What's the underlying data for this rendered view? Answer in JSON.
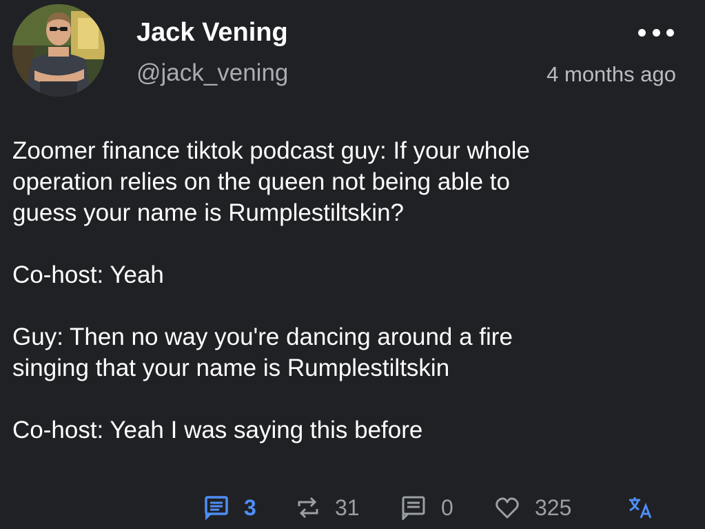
{
  "author": {
    "display_name": "Jack Vening",
    "handle": "@jack_vening"
  },
  "post": {
    "timestamp": "4 months ago",
    "paragraphs": [
      "Zoomer finance tiktok podcast guy: If your whole\noperation relies on the queen not being able to\nguess your name is Rumplestiltskin?",
      "Co-host: Yeah",
      "Guy: Then no way you're dancing around a fire\nsinging that your name is Rumplestiltskin",
      "Co-host: Yeah I was saying this before"
    ]
  },
  "actions": {
    "replies": {
      "icon": "reply-icon",
      "count": "3"
    },
    "reposts": {
      "icon": "repost-icon",
      "count": "31"
    },
    "quotes": {
      "icon": "quote-icon",
      "count": "0"
    },
    "likes": {
      "icon": "heart-icon",
      "count": "325"
    },
    "translate": {
      "icon": "translate-icon"
    }
  },
  "colors": {
    "background": "#202124",
    "primary_text": "#ffffff",
    "secondary_text": "#a9acb3",
    "accent": "#4f8ef7",
    "action_gray": "#9aa0a6"
  }
}
